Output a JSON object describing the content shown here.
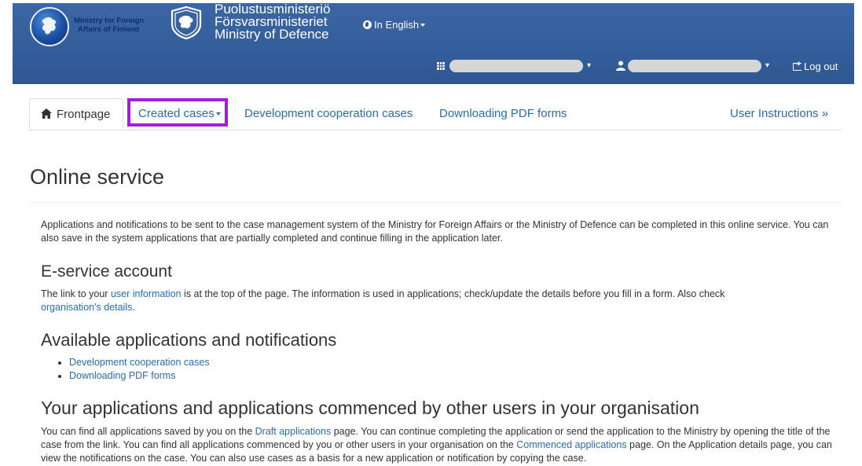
{
  "header": {
    "ministry_foreign_line1": "Ministry for Foreign",
    "ministry_foreign_line2": "Affairs of Finland",
    "mod_fi": "Puolustusministeriö",
    "mod_sv": "Försvarsministeriet",
    "mod_en": "Ministry of Defence",
    "language": "In English",
    "logout": "Log out"
  },
  "tabs": {
    "frontpage": "Frontpage",
    "created_cases": "Created cases",
    "dev_coop": "Development cooperation cases",
    "pdf_forms": "Downloading PDF forms",
    "user_instructions": "User Instructions »"
  },
  "content": {
    "title": "Online service",
    "intro": "Applications and notifications to be sent to the case management system of the Ministry for Foreign Affairs or the Ministry of Defence can be completed in this online service. You can also save in the system applications that are partially completed and continue filling in the application later.",
    "eservice": {
      "heading": "E-service account",
      "text1": "The link to your ",
      "link_user_info": "user information",
      "text2": " is at the top of the page. The information is used in applications; check/update the details before you fill in a form. Also check ",
      "link_org": "organisation's details",
      "text3": "."
    },
    "available": {
      "heading": "Available applications and notifications",
      "items": [
        "Development cooperation cases",
        "Downloading PDF forms"
      ]
    },
    "yours": {
      "heading": "Your applications and applications commenced by other users in your organisation",
      "text1": "You can find all applications saved by you on the ",
      "link_draft": "Draft applications",
      "text2": " page. You can continue completing the application or send the application to the Ministry by opening the title of the case from the link. You can find all applications commenced by you or other users in your organisation on the ",
      "link_commenced": "Commenced applications",
      "text3": " page. On the Application details page, you can view the notifications on the case. You can also use cases as a basis for a new application or notification by copying the case."
    }
  },
  "colors": {
    "header_bg": "#2f5892",
    "link": "#2a6cb0",
    "highlight": "#a21fd6"
  }
}
